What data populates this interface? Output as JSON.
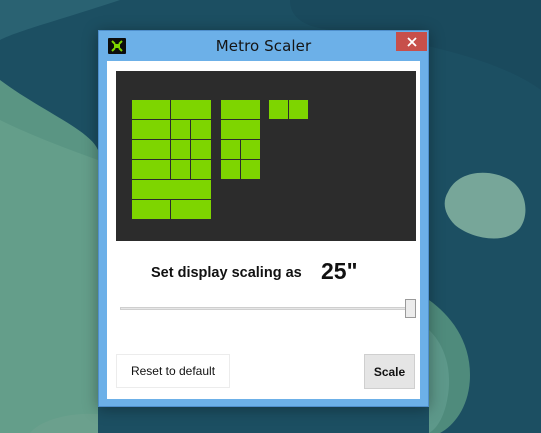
{
  "window": {
    "title": "Metro Scaler",
    "app_icon": "metro-scaler-icon",
    "close_icon": "close-icon"
  },
  "preview": {
    "tile_color": "#7ed500",
    "background_color": "#2c2c2c"
  },
  "scaling": {
    "label": "Set display scaling as",
    "value": "25\""
  },
  "slider": {
    "value_fraction": 1.0
  },
  "buttons": {
    "reset_label": "Reset to default",
    "scale_label": "Scale"
  },
  "colors": {
    "title_bar": "#6cb0e8",
    "close_button": "#c74f4a",
    "scale_button": "#e5e5e5"
  }
}
